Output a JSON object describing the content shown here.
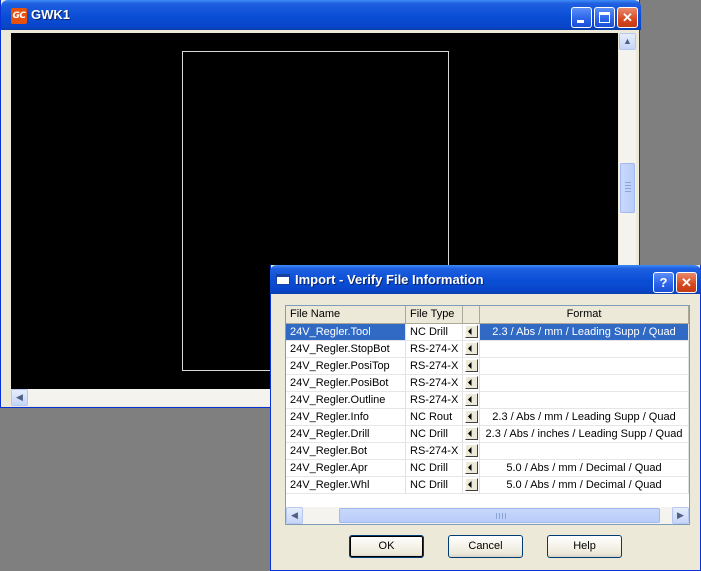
{
  "main_window": {
    "title": "GWK1",
    "logo_text": "GC"
  },
  "dialog": {
    "title": "Import - Verify File Information",
    "help_glyph": "?",
    "columns": [
      "File Name",
      "File Type",
      "",
      "Format"
    ],
    "rows": [
      {
        "name": "24V_Regler.Tool",
        "type": "NC Drill",
        "format": "2.3 / Abs / mm / Leading Supp / Quad",
        "selected": true
      },
      {
        "name": "24V_Regler.StopBot",
        "type": "RS-274-X",
        "format": ""
      },
      {
        "name": "24V_Regler.PosiTop",
        "type": "RS-274-X",
        "format": ""
      },
      {
        "name": "24V_Regler.PosiBot",
        "type": "RS-274-X",
        "format": ""
      },
      {
        "name": "24V_Regler.Outline",
        "type": "RS-274-X",
        "format": ""
      },
      {
        "name": "24V_Regler.Info",
        "type": "NC Rout",
        "format": "2.3 / Abs / mm / Leading Supp / Quad"
      },
      {
        "name": "24V_Regler.Drill",
        "type": "NC Drill",
        "format": "2.3 / Abs / inches / Leading Supp / Quad"
      },
      {
        "name": "24V_Regler.Bot",
        "type": "RS-274-X",
        "format": ""
      },
      {
        "name": "24V_Regler.Apr",
        "type": "NC Drill",
        "format": "5.0 / Abs / mm / Decimal / Quad"
      },
      {
        "name": "24V_Regler.Whl",
        "type": "NC Drill",
        "format": "5.0 / Abs / mm / Decimal / Quad"
      }
    ],
    "buttons": {
      "ok": "OK",
      "cancel": "Cancel",
      "help": "Help"
    }
  },
  "colors": {
    "titlebar": "#0a4ed6",
    "canvas": "#000000",
    "selection": "#316ac5",
    "dialog_face": "#ece9d8"
  },
  "icons": {
    "window_logo": "gc-logo-icon",
    "minimize": "minimize-icon",
    "maximize": "maximize-icon",
    "close": "close-icon",
    "dialog": "window-icon",
    "help": "help-icon",
    "scroll_up": "arrow-up-icon",
    "scroll_left": "arrow-left-icon",
    "scroll_right": "arrow-right-icon",
    "dropdown": "dropdown-icon"
  }
}
